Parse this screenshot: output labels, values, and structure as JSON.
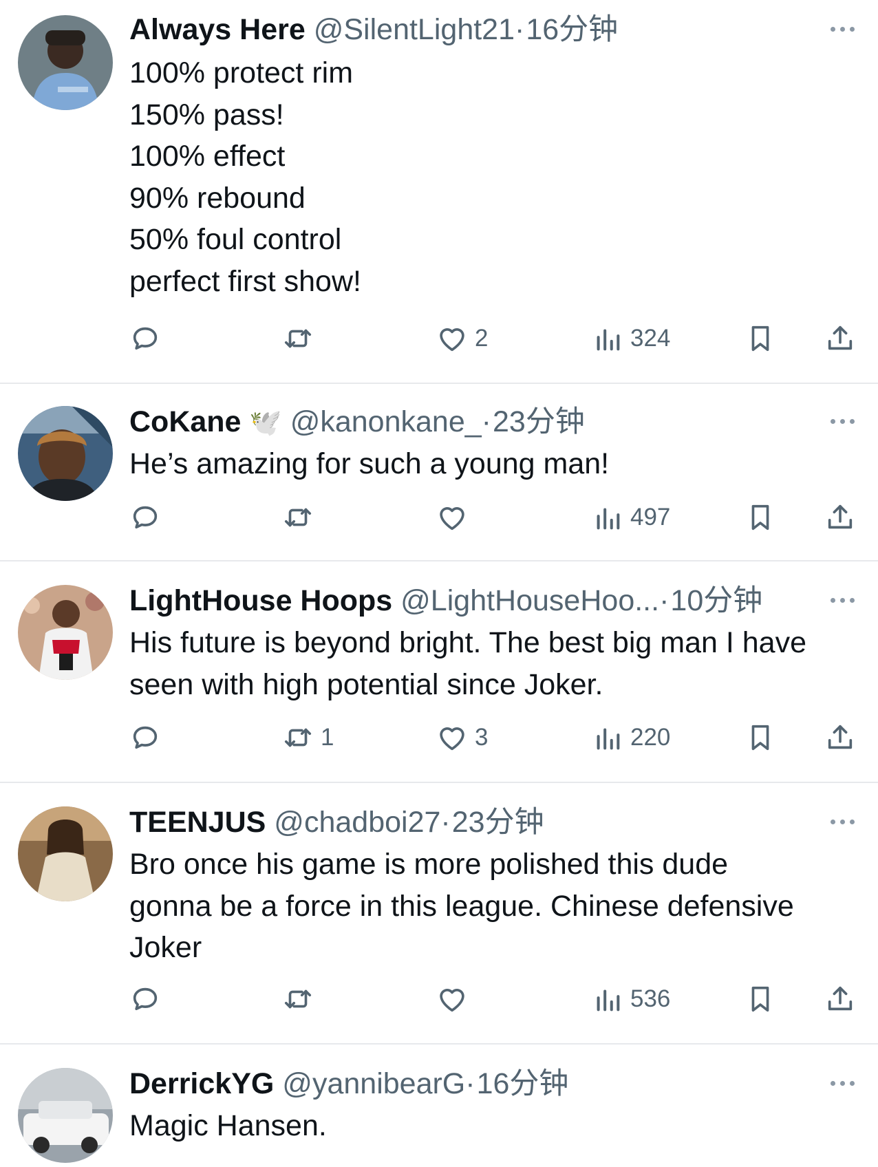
{
  "colors": {
    "text": "#0f1419",
    "secondary": "#536471",
    "divider": "#e7e9ec",
    "more_dots": "#8b98a5"
  },
  "icons": {
    "reply": "speech-bubble-icon",
    "retweet": "retweet-arrows-icon",
    "like": "heart-icon",
    "views": "bar-chart-icon",
    "bookmark": "bookmark-icon",
    "share": "share-upload-icon",
    "more": "more-dots-icon",
    "badge": "dove-olive-branch-icon"
  },
  "tweets": [
    {
      "name": "Always Here",
      "handle": "@SilentLight21",
      "sep": "·",
      "time": "16分钟",
      "lines": [
        "100% protect rim",
        "150% pass!",
        "100% effect",
        "90% rebound",
        "50% foul control",
        "perfect first show!"
      ],
      "stats": {
        "replies": "",
        "retweets": "",
        "likes": "2",
        "views": "324"
      }
    },
    {
      "name": "CoKane",
      "badge": "🕊️",
      "handle": "@kanonkane_",
      "sep": "·",
      "time": "23分钟",
      "lines": [
        "He’s amazing for such a young man!"
      ],
      "stats": {
        "replies": "",
        "retweets": "",
        "likes": "",
        "views": "497"
      }
    },
    {
      "name": "LightHouse Hoops",
      "handle": "@LightHouseHoo...",
      "sep": "·",
      "time": "10分钟",
      "lines": [
        "His future is beyond bright. The best big man I have",
        "seen with high potential since Joker."
      ],
      "stats": {
        "replies": "",
        "retweets": "1",
        "likes": "3",
        "views": "220"
      }
    },
    {
      "name": "TEENJUS",
      "handle": "@chadboi27",
      "sep": "·",
      "time": "23分钟",
      "lines": [
        "Bro once his game is more polished this dude",
        "gonna be a force in this league. Chinese defensive",
        "Joker"
      ],
      "stats": {
        "replies": "",
        "retweets": "",
        "likes": "",
        "views": "536"
      }
    },
    {
      "name": "DerrickYG",
      "handle": "@yannibearG",
      "sep": "·",
      "time": "16分钟",
      "lines": [
        "Magic Hansen."
      ]
    }
  ]
}
